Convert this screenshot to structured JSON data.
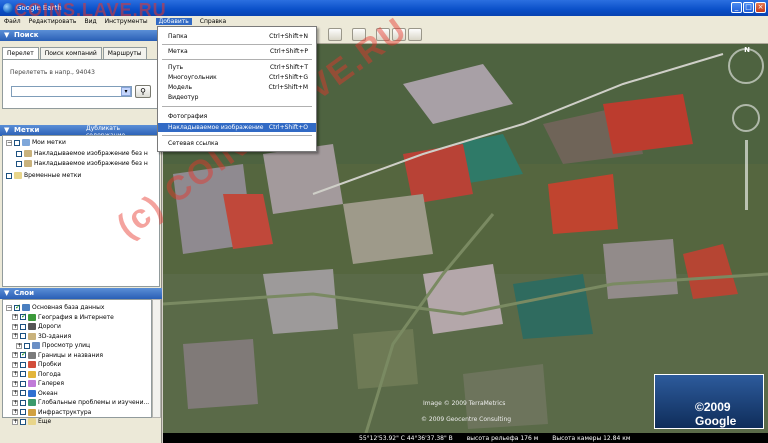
{
  "window": {
    "title": "Google Earth"
  },
  "watermark": {
    "top": "COINS.LAVE.RU",
    "diag": "(c) COINS.LAVE.RU"
  },
  "menubar": [
    "Файл",
    "Редактировать",
    "Вид",
    "Инструменты",
    "Добавить",
    "Справка"
  ],
  "add_menu": [
    {
      "label": "Папка",
      "shortcut": "Ctrl+Shift+N"
    },
    {
      "label": "Метка",
      "shortcut": "Ctrl+Shift+P"
    },
    {
      "label": "Путь",
      "shortcut": "Ctrl+Shift+T"
    },
    {
      "label": "Многоугольник",
      "shortcut": "Ctrl+Shift+G"
    },
    {
      "label": "Модель",
      "shortcut": "Ctrl+Shift+M"
    },
    {
      "label": "Видеотур",
      "shortcut": ""
    },
    {
      "label": "Фотография",
      "shortcut": ""
    },
    {
      "label": "Накладываемое изображение",
      "shortcut": "Ctrl+Shift+O"
    },
    {
      "label": "Сетевая ссылка",
      "shortcut": ""
    }
  ],
  "search": {
    "header": "Поиск",
    "tabs": [
      "Перелет",
      "Поиск компаний",
      "Маршруты"
    ],
    "hint": "Перелететь в напр., 94043",
    "input_value": ""
  },
  "places": {
    "header": "Метки",
    "add_button": "Дубликать содержание",
    "items": [
      {
        "label": "Мои метки"
      },
      {
        "label": "Накладываемое изображение без н"
      },
      {
        "label": "Накладываемое изображение без н"
      },
      {
        "label": "Временные метки"
      }
    ]
  },
  "layers": {
    "header": "Слои",
    "items": [
      {
        "label": "Основная база данных",
        "checked": true
      },
      {
        "label": "География в Интернете",
        "checked": true
      },
      {
        "label": "Дороги",
        "checked": false
      },
      {
        "label": "3D-здания",
        "checked": false
      },
      {
        "label": "Просмотр улиц",
        "checked": false
      },
      {
        "label": "Границы и названия",
        "checked": true
      },
      {
        "label": "Пробки",
        "checked": false
      },
      {
        "label": "Погода",
        "checked": false
      },
      {
        "label": "Галерея",
        "checked": false
      },
      {
        "label": "Океан",
        "checked": false
      },
      {
        "label": "Глобальные проблемы и изучени...",
        "checked": false
      },
      {
        "label": "Инфраструктура",
        "checked": false
      },
      {
        "label": "Еще",
        "checked": false
      }
    ]
  },
  "map": {
    "north_label": "N",
    "copyright1": "Image © 2009 TerraMetrics",
    "copyright2": "© 2009 Geocentre Consulting",
    "logo": "©2009 Google"
  },
  "status": {
    "coords": "55°12'53.92\" С   44°36'37.38\" В",
    "elevation": "высота рельефа  176 м",
    "eye": "Высота камеры   12.84 км"
  },
  "colors": {
    "accent": "#316ac5",
    "titlebar": "#0a4fc8",
    "watermark": "#e8362b"
  }
}
